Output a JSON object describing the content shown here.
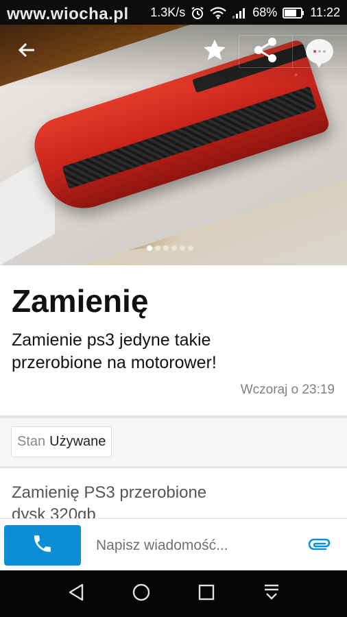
{
  "watermark": "www.wiocha.pl",
  "status": {
    "speed": "1.3K/s",
    "battery": "68%",
    "time": "11:22"
  },
  "icons": {
    "back": "back-arrow-icon",
    "star": "star-icon",
    "share": "share-icon",
    "chat": "chat-bubble-icon",
    "phone": "phone-icon",
    "attach": "paperclip-icon",
    "nav_back": "triangle-back-icon",
    "nav_home": "circle-home-icon",
    "nav_recents": "square-recents-icon",
    "nav_notifications": "notification-down-icon"
  },
  "gallery": {
    "image_count": 6,
    "active_index": 0
  },
  "listing": {
    "title": "Zamienię",
    "short_description": "Zamienie ps3 jedyne takie przerobione na motorower!",
    "date": "Wczoraj o 23:19",
    "param_key": "Stan",
    "param_value": "Używane",
    "description": "Zamienię PS3 przerobione dysk 320gb"
  },
  "actions": {
    "message_placeholder": "Napisz wiadomość..."
  },
  "colors": {
    "call_button": "#0b8ed6",
    "attach_icon": "#0b8ed6",
    "status_bar": "#0d0d0d",
    "nav_bar": "#050505"
  }
}
